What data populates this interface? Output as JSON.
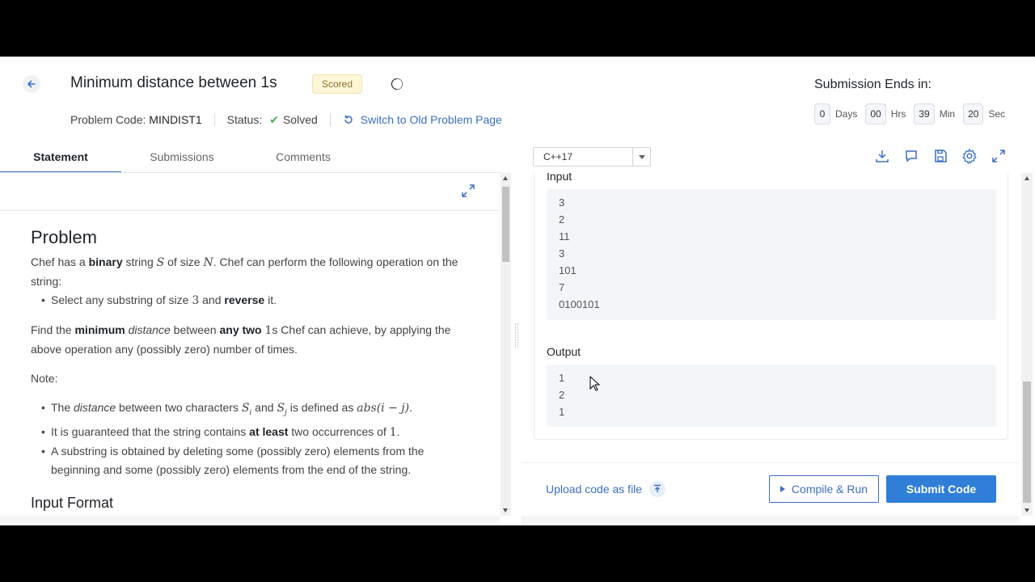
{
  "header": {
    "title": "Minimum distance between 1s",
    "badge": "Scored",
    "problem_code_label": "Problem Code:",
    "problem_code": "MINDIST1",
    "status_label": "Status:",
    "status_value": "Solved",
    "switch_link": "Switch to Old Problem Page"
  },
  "timer": {
    "heading": "Submission Ends in:",
    "days": "0",
    "days_label": "Days",
    "hours": "00",
    "hours_label": "Hrs",
    "minutes": "39",
    "minutes_label": "Min",
    "seconds": "20",
    "seconds_label": "Sec"
  },
  "tabs": [
    {
      "label": "Statement",
      "active": true
    },
    {
      "label": "Submissions",
      "active": false
    },
    {
      "label": "Comments",
      "active": false
    }
  ],
  "statement": {
    "heading": "Problem",
    "p1_pre": "Chef has a ",
    "p1_bold": "binary",
    "p1_mid": " string ",
    "p1_S": "S",
    "p1_mid2": " of size ",
    "p1_N": "N",
    "p1_post": ". Chef can perform the following operation on the string:",
    "b1_pre": "Select any substring of size ",
    "b1_num": "3",
    "b1_mid": " and ",
    "b1_bold": "reverse",
    "b1_post": " it.",
    "p2_pre": "Find the ",
    "p2_bold1": "minimum",
    "p2_italic": "distance",
    "p2_mid": " between ",
    "p2_bold2": "any two",
    "p2_math": "1",
    "p2_post": "s Chef can achieve, by applying the above operation any (possibly zero) number of times.",
    "note": "Note:",
    "n1_pre": "The ",
    "n1_italic": "distance",
    "n1_mid": " between two characters ",
    "n1_Si": "S",
    "n1_Si_sub": "i",
    "n1_and": " and ",
    "n1_Sj": "S",
    "n1_Sj_sub": "j",
    "n1_mid2": " is defined as ",
    "n1_formula": "abs(i − j)",
    "n1_post": ".",
    "n2_pre": "It is guaranteed that the string contains ",
    "n2_bold": "at least",
    "n2_mid": " two occurrences of ",
    "n2_math": "1",
    "n2_post": ".",
    "n3": "A substring is obtained by deleting some (possibly zero) elements from the beginning and some (possibly zero) elements from the end of the string.",
    "input_format_heading": "Input Format"
  },
  "editor": {
    "language": "C++17",
    "toolbar_icons": [
      "download-icon",
      "comment-icon",
      "save-icon",
      "settings-icon",
      "fullscreen-icon"
    ]
  },
  "sample": {
    "input_label": "Input",
    "input_lines": [
      "3",
      "2",
      "11",
      "3",
      "101",
      "7",
      "0100101"
    ],
    "output_label": "Output",
    "output_lines": [
      "1",
      "2",
      "1"
    ]
  },
  "footer": {
    "upload_label": "Upload code as file",
    "compile_label": "Compile & Run",
    "submit_label": "Submit Code"
  },
  "colors": {
    "accent": "#3b6fc4",
    "submit": "#2f7fd8",
    "solved": "#4caf50",
    "badge_bg": "#fff6d8"
  }
}
